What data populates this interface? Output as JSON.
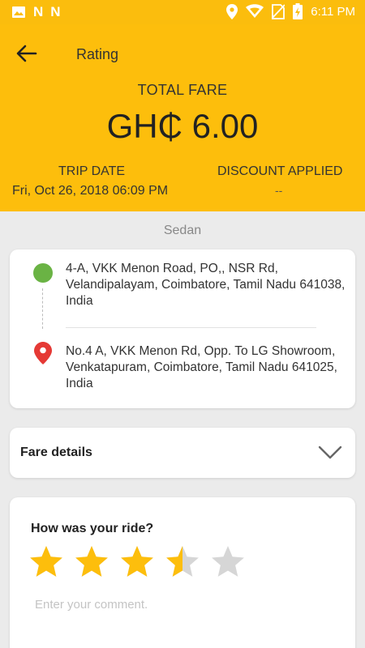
{
  "status_bar": {
    "icons": [
      "image-icon",
      "n-icon",
      "n-icon",
      "location-icon",
      "wifi-icon",
      "no-sim-icon",
      "battery-charging-icon"
    ],
    "n_letter": "N",
    "time": "6:11 PM"
  },
  "header": {
    "title": "Rating",
    "total_fare_label": "TOTAL FARE",
    "total_fare_amount": "GH₵ 6.00",
    "trip_date_label": "TRIP DATE",
    "trip_date_value": "Fri, Oct 26, 2018 06:09 PM",
    "discount_label": "DISCOUNT APPLIED",
    "discount_value": "--"
  },
  "vehicle_type": "Sedan",
  "route": {
    "pickup": "4-A, VKK Menon Road, PO,, NSR Rd, Velandipalayam, Coimbatore, Tamil Nadu 641038, India",
    "drop": "No.4 A, VKK Menon Rd, Opp. To LG Showroom, Venkatapuram, Coimbatore, Tamil Nadu 641025, India"
  },
  "fare_details": {
    "label": "Fare details"
  },
  "rating": {
    "question": "How was your ride?",
    "value": 3.5,
    "max": 5,
    "comment_placeholder": "Enter your comment."
  },
  "colors": {
    "brand_yellow": "#fdbe0c",
    "star_filled": "#fdbe0c",
    "star_empty": "#d6d6d6",
    "pickup_green": "#6ab344",
    "drop_red": "#e53935"
  }
}
